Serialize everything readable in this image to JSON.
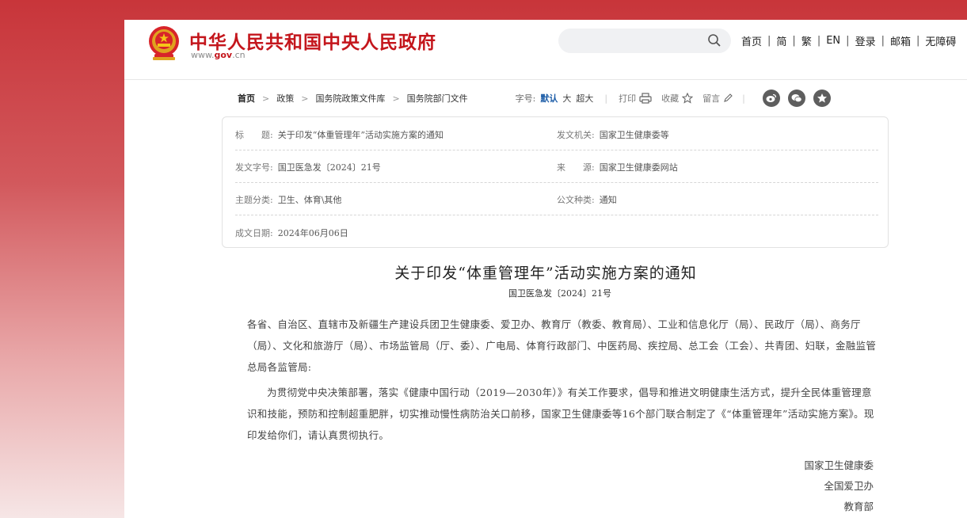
{
  "header": {
    "site_title": "中华人民共和国中央人民政府",
    "site_url_prefix": "www.",
    "site_url_brand": "gov",
    "site_url_suffix": ".cn",
    "links": [
      "首页",
      "简",
      "繁",
      "EN",
      "登录",
      "邮箱",
      "无障碍"
    ]
  },
  "breadcrumb": {
    "items": [
      "首页",
      "政策",
      "国务院政策文件库",
      "国务院部门文件"
    ]
  },
  "tools": {
    "font_size_label": "字号:",
    "font_options": [
      "默认",
      "大",
      "超大"
    ],
    "print": "打印",
    "favorite": "收藏",
    "comment": "留言"
  },
  "info": {
    "title_label": "标　　题:",
    "title_value": "关于印发“体重管理年”活动实施方案的通知",
    "issuer_label": "发文机关:",
    "issuer_value": "国家卫生健康委等",
    "doc_no_label": "发文字号:",
    "doc_no_value": "国卫医急发〔2024〕21号",
    "source_label": "来　　源:",
    "source_value": "国家卫生健康委网站",
    "category_label": "主题分类:",
    "category_value": "卫生、体育\\其他",
    "type_label": "公文种类:",
    "type_value": "通知",
    "date_label": "成文日期:",
    "date_value": "2024年06月06日"
  },
  "document": {
    "title": "关于印发“体重管理年”活动实施方案的通知",
    "number": "国卫医急发〔2024〕21号",
    "addressee": "各省、自治区、直辖市及新疆生产建设兵团卫生健康委、爱卫办、教育厅（教委、教育局）、工业和信息化厅（局）、民政厅（局）、商务厅（局）、文化和旅游厅（局）、市场监管局（厅、委）、广电局、体育行政部门、中医药局、疾控局、总工会（工会）、共青团、妇联，金融监管总局各监管局:",
    "body": "为贯彻党中央决策部署，落实《健康中国行动（2019—2030年）》有关工作要求，倡导和推进文明健康生活方式，提升全民体重管理意识和技能，预防和控制超重肥胖，切实推动慢性病防治关口前移，国家卫生健康委等16个部门联合制定了《“体重管理年”活动实施方案》。现印发给你们，请认真贯彻执行。",
    "signatures": [
      "国家卫生健康委",
      "全国爱卫办",
      "教育部"
    ]
  },
  "colors": {
    "brand_red": "#c4161c",
    "link_blue": "#1e5ea8"
  }
}
